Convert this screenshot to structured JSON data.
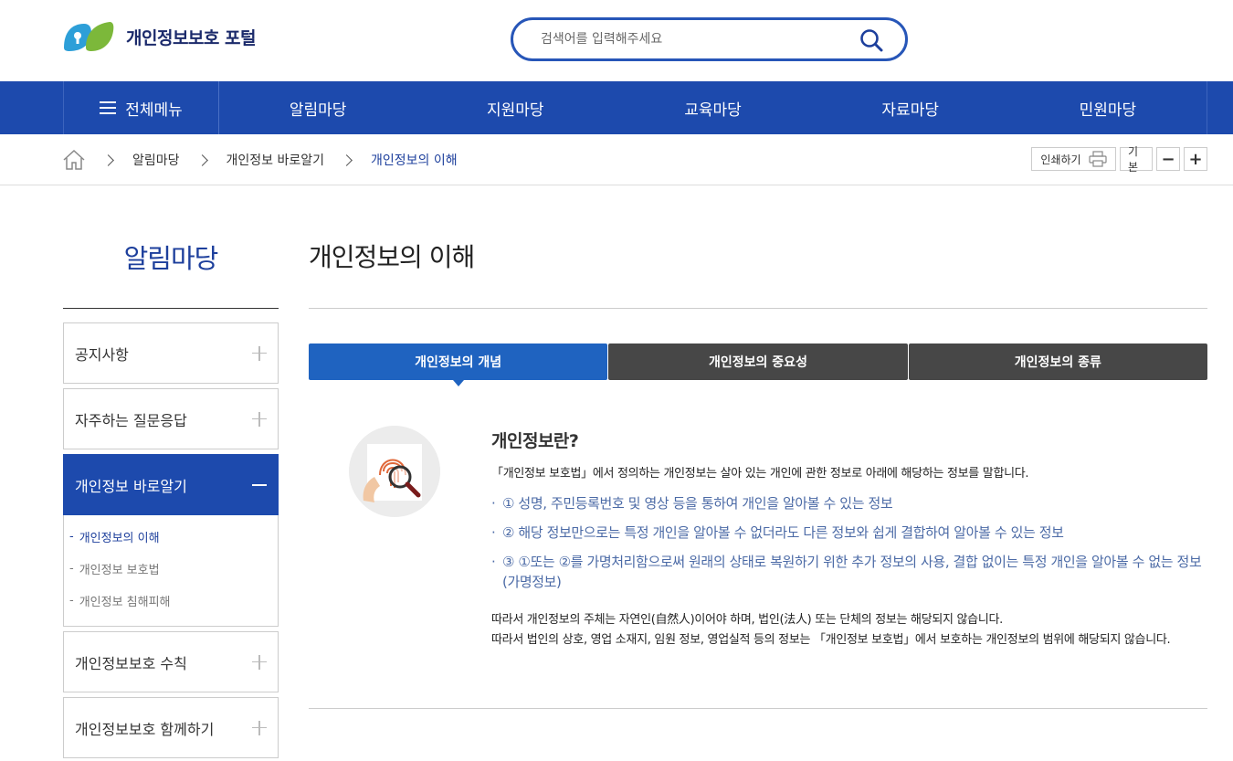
{
  "header": {
    "logo_text": "개인정보보호 포털",
    "search_placeholder": "검색어를 입력해주세요"
  },
  "gnb": {
    "all_menu": "전체메뉴",
    "items": [
      "알림마당",
      "지원마당",
      "교육마당",
      "자료마당",
      "민원마당"
    ]
  },
  "breadcrumb": {
    "items": [
      "알림마당",
      "개인정보 바로알기",
      "개인정보의 이해"
    ]
  },
  "tools": {
    "print": "인쇄하기",
    "default": "기본",
    "minus": "−",
    "plus": "+"
  },
  "sidebar": {
    "title": "알림마당",
    "items": [
      {
        "label": "공지사항"
      },
      {
        "label": "자주하는 질문응답"
      },
      {
        "label": "개인정보 바로알기",
        "active": true
      },
      {
        "label": "개인정보보호 수칙"
      },
      {
        "label": "개인정보보호 함께하기"
      }
    ],
    "sub_items": [
      "개인정보의 이해",
      "개인정보 보호법",
      "개인정보 침해피해"
    ]
  },
  "content": {
    "title": "개인정보의 이해",
    "tabs": [
      "개인정보의 개념",
      "개인정보의 중요성",
      "개인정보의 종류"
    ],
    "heading": "개인정보란?",
    "lead": "「개인정보 보호법」에서 정의하는 개인정보는 살아 있는 개인에 관한 정보로 아래에 해당하는 정보를 말합니다.",
    "points": [
      "① 성명, 주민등록번호 및 영상 등을 통하여 개인을 알아볼 수 있는 정보",
      "② 해당 정보만으로는 특정 개인을 알아볼 수 없더라도 다른 정보와 쉽게 결합하여 알아볼 수 있는 정보",
      "③ ①또는 ②를 가명처리함으로써 원래의 상태로 복원하기 위한 추가 정보의 사용, 결합 없이는 특정 개인을 알아볼 수 없는 정보(가명정보)"
    ],
    "foot_1": "따라서 개인정보의 주체는 자연인(自然人)이어야 하며, 법인(法人) 또는 단체의 정보는 해당되지 않습니다.",
    "foot_2": "따라서 법인의 상호, 영업 소재지, 임원 정보, 영업실적 등의 정보는 「개인정보 보호법」에서 보호하는 개인정보의 범위에 해당되지 않습니다."
  },
  "colors": {
    "primary": "#1d4aad",
    "tab_active": "#1f63c0",
    "tab_inactive": "#474747",
    "point_text": "#4b6aa6"
  }
}
